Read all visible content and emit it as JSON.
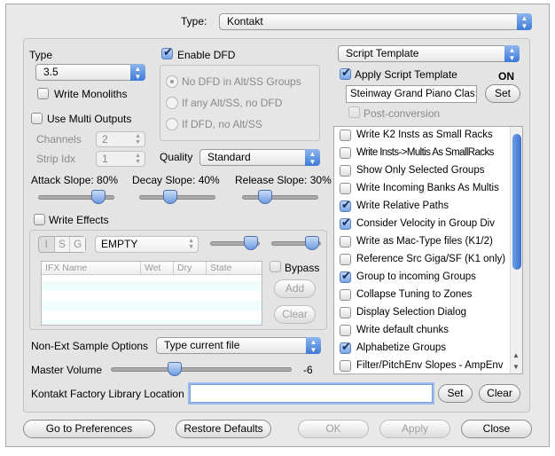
{
  "header": {
    "type_label": "Type:",
    "type_value": "Kontakt"
  },
  "left": {
    "type_label": "Type",
    "type_value": "3.5",
    "write_monoliths": "Write Monoliths",
    "use_multi_outputs": "Use Multi Outputs",
    "channels_label": "Channels",
    "channels_value": "2",
    "strip_label": "Strip Idx",
    "strip_value": "1",
    "enable_dfd": "Enable DFD",
    "dfd_options": [
      "No DFD in Alt/SS Groups",
      "If any Alt/SS, no DFD",
      "If DFD, no Alt/SS"
    ],
    "quality_label": "Quality",
    "quality_value": "Standard",
    "attack_label": "Attack Slope: 80%",
    "attack": 80,
    "decay_label": "Decay Slope: 40%",
    "decay": 40,
    "release_label": "Release Slope: 30%",
    "release": 30,
    "write_effects": "Write Effects",
    "isg": [
      "I",
      "S",
      "G"
    ],
    "effect_value": "EMPTY",
    "fx_columns": [
      "IFX Name",
      "Wet",
      "Dry",
      "State"
    ],
    "bypass": "Bypass",
    "add": "Add",
    "clear": "Clear",
    "nonext_label": "Non-Ext Sample Options",
    "nonext_value": "Type current file",
    "master_label": "Master Volume",
    "master_value": "-6"
  },
  "right": {
    "script_template": "Script Template",
    "apply_script": "Apply Script Template",
    "on": "ON",
    "template_name": "Steinway Grand Piano Clas:",
    "set": "Set",
    "post_conversion": "Post-conversion",
    "options": [
      {
        "label": "Write K2 Insts as Small Racks",
        "checked": false
      },
      {
        "label": "Write Insts->Multis As SmallRacks",
        "checked": false
      },
      {
        "label": "Show Only Selected Groups",
        "checked": false
      },
      {
        "label": "Write Incoming Banks As Multis",
        "checked": false
      },
      {
        "label": "Write Relative Paths",
        "checked": true
      },
      {
        "label": "Consider Velocity in Group Div",
        "checked": true
      },
      {
        "label": "Write as Mac-Type files (K1/2)",
        "checked": false
      },
      {
        "label": "Reference Src Giga/SF (K1 only)",
        "checked": false
      },
      {
        "label": "Group to incoming Groups",
        "checked": true
      },
      {
        "label": "Collapse Tuning to Zones",
        "checked": false
      },
      {
        "label": "Display Selection Dialog",
        "checked": false
      },
      {
        "label": "Write default chunks",
        "checked": false
      },
      {
        "label": "Alphabetize Groups",
        "checked": true
      },
      {
        "label": "Filter/PitchEnv Slopes - AmpEnv",
        "checked": false
      }
    ]
  },
  "library": {
    "label": "Kontakt Factory Library Location",
    "value": "",
    "set": "Set",
    "clear": "Clear"
  },
  "footer": {
    "prefs": "Go to Preferences",
    "restore": "Restore Defaults",
    "ok": "OK",
    "apply": "Apply",
    "close": "Close"
  }
}
